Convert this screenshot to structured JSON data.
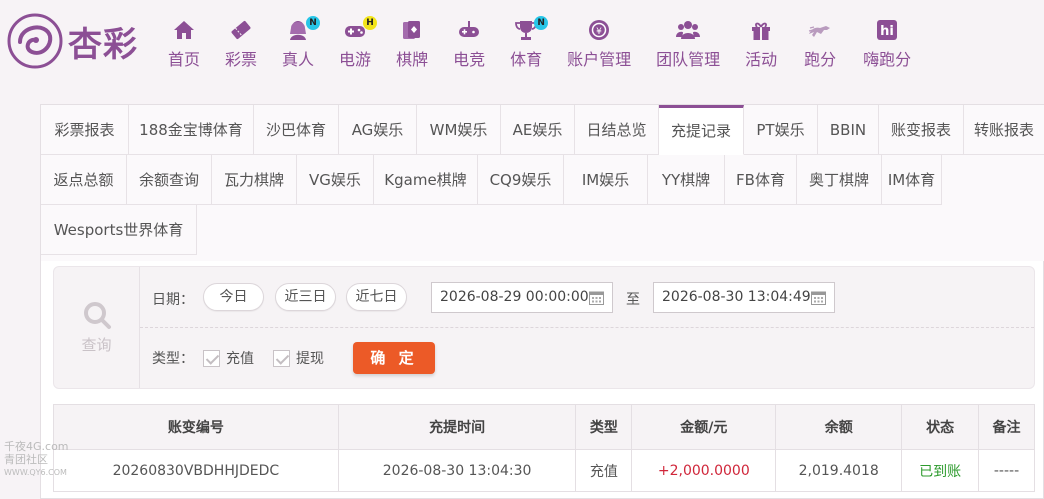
{
  "logo": {
    "text": "杏彩"
  },
  "nav": [
    {
      "label": "首页",
      "icon": "home-icon",
      "badge": ""
    },
    {
      "label": "彩票",
      "icon": "lottery-ticket-icon",
      "badge": ""
    },
    {
      "label": "真人",
      "icon": "live-dealer-icon",
      "badge": "N"
    },
    {
      "label": "电游",
      "icon": "gamepad-icon",
      "badge": "H"
    },
    {
      "label": "棋牌",
      "icon": "cards-icon",
      "badge": ""
    },
    {
      "label": "电竞",
      "icon": "esports-controller-icon",
      "badge": ""
    },
    {
      "label": "体育",
      "icon": "trophy-icon",
      "badge": "N"
    },
    {
      "label": "账户管理",
      "icon": "account-icon",
      "badge": ""
    },
    {
      "label": "团队管理",
      "icon": "team-icon",
      "badge": ""
    },
    {
      "label": "活动",
      "icon": "gift-icon",
      "badge": ""
    },
    {
      "label": "跑分",
      "icon": "running-horse-icon",
      "badge": ""
    },
    {
      "label": "嗨跑分",
      "icon": "hi-icon",
      "badge": ""
    }
  ],
  "tabs": [
    "彩票报表",
    "188金宝博体育",
    "沙巴体育",
    "AG娱乐",
    "WM娱乐",
    "AE娱乐",
    "日结总览",
    "充提记录",
    "PT娱乐",
    "BBIN",
    "账变报表",
    "转账报表",
    "返点总额",
    "余额查询",
    "瓦力棋牌",
    "VG娱乐",
    "Kgame棋牌",
    "CQ9娱乐",
    "IM娱乐",
    "YY棋牌",
    "FB体育",
    "奥丁棋牌",
    "IM体育",
    "Wesports世界体育"
  ],
  "query": {
    "title": "查询",
    "date_label": "日期：",
    "quick": [
      "今日",
      "近三日",
      "近七日"
    ],
    "start": "2026-08-29 00:00:00",
    "to": "至",
    "end": "2026-08-30 13:04:49",
    "type_label": "类型：",
    "types": [
      "充值",
      "提现"
    ],
    "confirm": "确 定"
  },
  "table": {
    "headers": [
      "账变编号",
      "充提时间",
      "类型",
      "金额/元",
      "余额",
      "状态",
      "备注"
    ],
    "rows": [
      [
        "20260830VBDHHJDEDC",
        "2026-08-30 13:04:30",
        "充值",
        "+2,000.0000",
        "2,019.4018",
        "已到账",
        "-----"
      ]
    ]
  },
  "watermark": [
    "千夜4G.com",
    "青团社区",
    "WWW.QY6.COM"
  ],
  "colors": {
    "brand": "#8c4f95",
    "confirm": "#ec5a27",
    "amount": "#d0263a",
    "status": "#2e9b2e",
    "badge_n": "#27c6e8",
    "badge_h": "#f2e41a"
  }
}
